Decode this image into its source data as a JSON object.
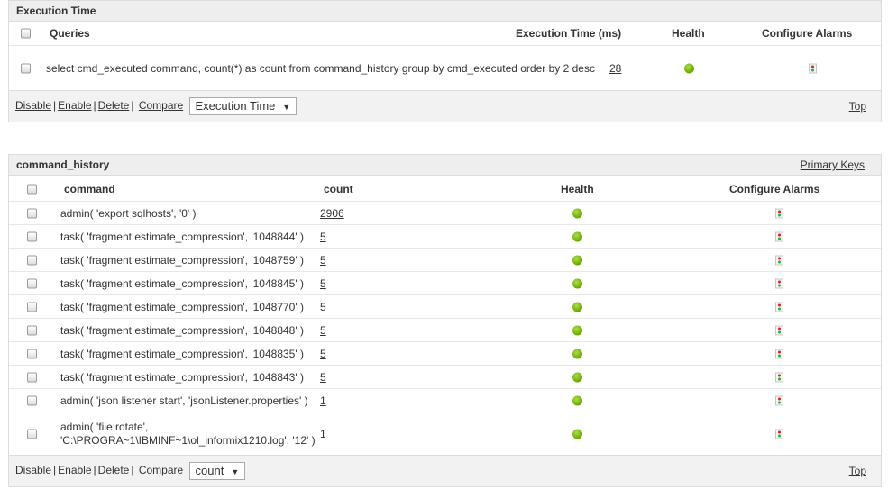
{
  "exec_panel": {
    "title": "Execution Time",
    "columns": {
      "queries": "Queries",
      "exec_time": "Execution Time (ms)",
      "health": "Health",
      "alarms": "Configure Alarms"
    },
    "rows": [
      {
        "query": "select cmd_executed command, count(*) as count from command_history group by cmd_executed order by 2 desc",
        "time": "28",
        "health": "green"
      }
    ],
    "footer": {
      "disable": "Disable",
      "enable": "Enable",
      "delete": "Delete",
      "compare": "Compare",
      "select_value": "Execution Time",
      "top": "Top"
    }
  },
  "history_panel": {
    "title": "command_history",
    "header_link": "Primary Keys",
    "columns": {
      "command": "command",
      "count": "count",
      "health": "Health",
      "alarms": "Configure Alarms"
    },
    "rows": [
      {
        "command": "admin( 'export sqlhosts', '0' )",
        "count": "2906"
      },
      {
        "command": "task( 'fragment estimate_compression', '1048844' )",
        "count": "5"
      },
      {
        "command": "task( 'fragment estimate_compression', '1048759' )",
        "count": "5"
      },
      {
        "command": "task( 'fragment estimate_compression', '1048845' )",
        "count": "5"
      },
      {
        "command": "task( 'fragment estimate_compression', '1048770' )",
        "count": "5"
      },
      {
        "command": "task( 'fragment estimate_compression', '1048848' )",
        "count": "5"
      },
      {
        "command": "task( 'fragment estimate_compression', '1048835' )",
        "count": "5"
      },
      {
        "command": "task( 'fragment estimate_compression', '1048843' )",
        "count": "5"
      },
      {
        "command": "admin( 'json listener start', 'jsonListener.properties' )",
        "count": "1"
      },
      {
        "command": "admin( 'file rotate', 'C:\\PROGRA~1\\IBMINF~1\\ol_informix1210.log', '12' )",
        "count": "1"
      }
    ],
    "footer": {
      "disable": "Disable",
      "enable": "Enable",
      "delete": "Delete",
      "compare": "Compare",
      "select_value": "count",
      "top": "Top"
    }
  },
  "colors": {
    "health_green": "#6aa300",
    "header_bg": "#eeeeee",
    "footer_bg": "#f2f2f2"
  }
}
